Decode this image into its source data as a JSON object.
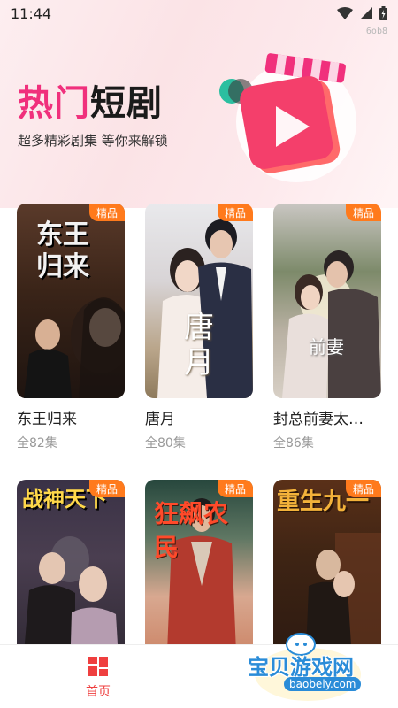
{
  "status_bar": {
    "time": "11:44",
    "device_tag": "6ob8",
    "icons": [
      "wifi-icon",
      "signal-icon",
      "battery-icon"
    ]
  },
  "hero": {
    "title_part1": "热门",
    "title_part2": "短剧",
    "subtitle": "超多精彩剧集 等你来解锁",
    "accent_color": "#f0307c"
  },
  "dramas": [
    {
      "title": "东王归来",
      "episodes": "全82集",
      "badge": "精品",
      "poster_art": "东王归来"
    },
    {
      "title": "唐月",
      "episodes": "全80集",
      "badge": "精品",
      "poster_art": "唐月"
    },
    {
      "title": "封总前妻太…",
      "episodes": "全86集",
      "badge": "精品",
      "poster_art": "前妻"
    },
    {
      "title": "",
      "episodes": "",
      "badge": "精品",
      "poster_art": "战神天下"
    },
    {
      "title": "",
      "episodes": "",
      "badge": "精品",
      "poster_art": "狂飙农民"
    },
    {
      "title": "",
      "episodes": "",
      "badge": "精品",
      "poster_art": "重生九一"
    }
  ],
  "bottom_nav": {
    "home_label": "首页",
    "active_color": "#ef3f3f"
  },
  "watermark": {
    "text": "宝贝游戏网",
    "url": "baobely.com"
  }
}
